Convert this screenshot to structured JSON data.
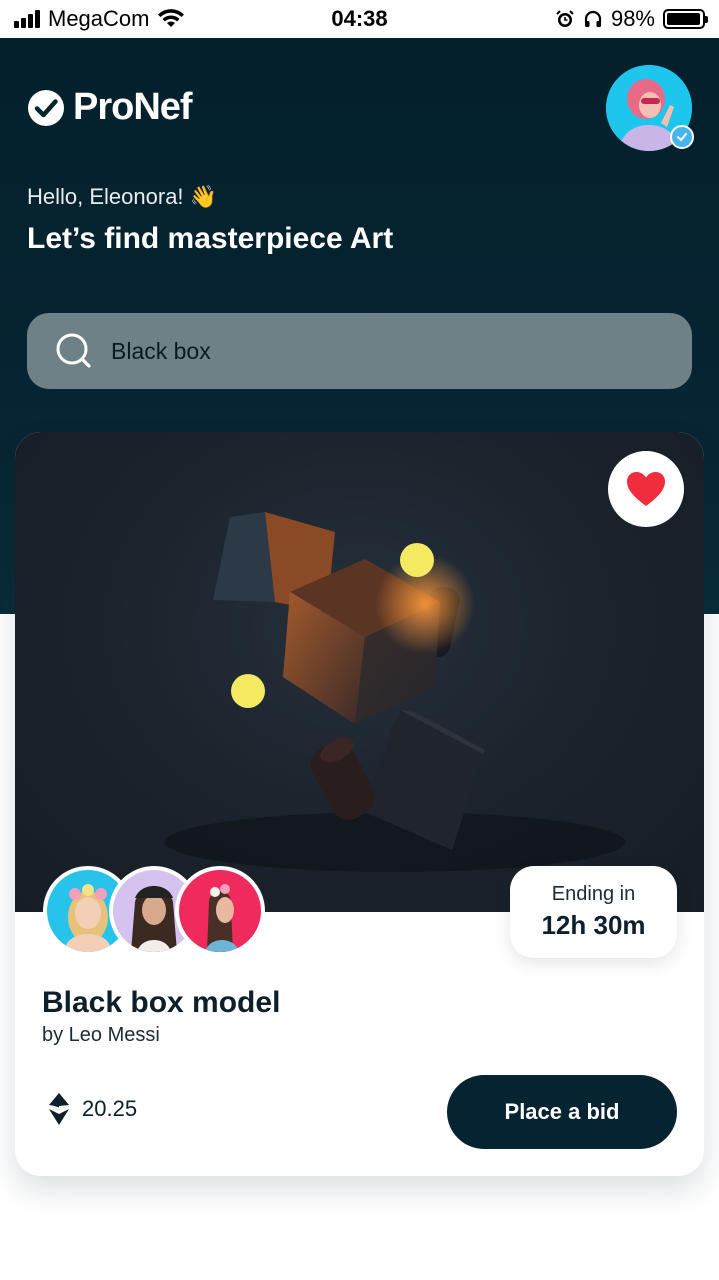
{
  "status_bar": {
    "carrier": "MegaCom",
    "time": "04:38",
    "battery": "98%",
    "battery_level": 0.98
  },
  "app": {
    "name": "ProNef"
  },
  "header": {
    "greeting": "Hello, Eleonora!",
    "greeting_emoji": "👋",
    "headline": "Let’s find masterpiece Art"
  },
  "search": {
    "value": "Black box",
    "icon": "search-icon"
  },
  "card": {
    "title": "Black box model",
    "author": "by Leo Messi",
    "ending_label": "Ending in",
    "ending_value": "12h 30m",
    "price": "20.25",
    "currency_icon": "ethereum-icon",
    "bid_label": "Place a bid",
    "favorited": true
  },
  "colors": {
    "brand_dark": "#062331",
    "heart": "#ef2d3c",
    "search_bg": "#6e8186",
    "accent_dot": "#f4ea62"
  }
}
